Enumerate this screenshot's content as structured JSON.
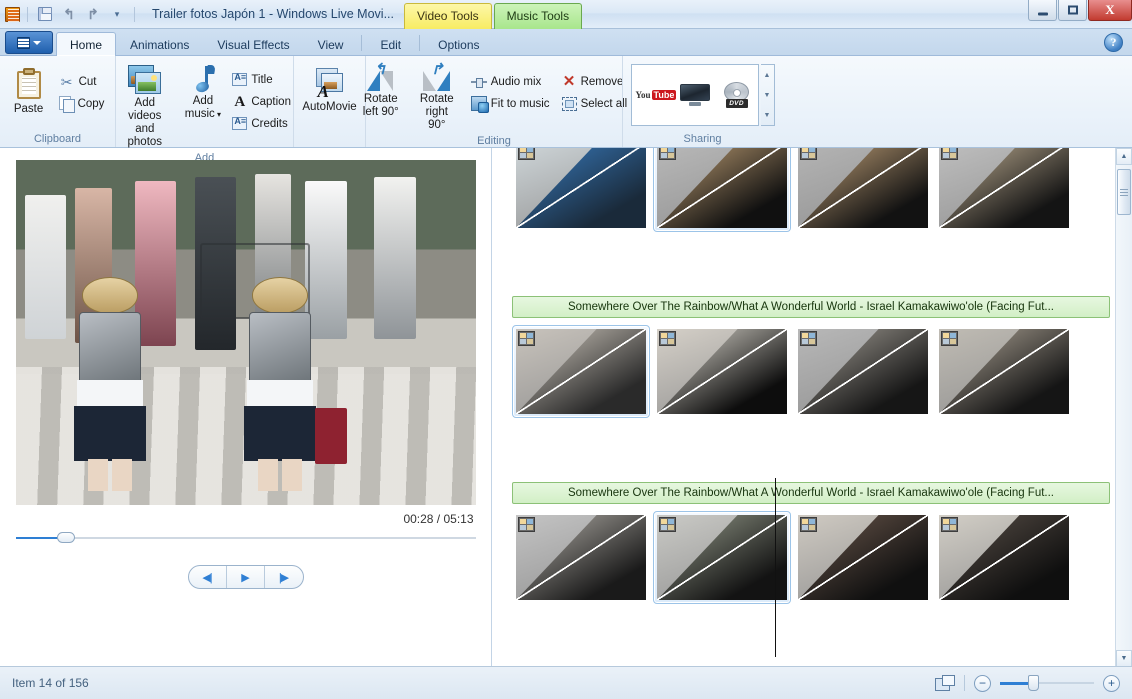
{
  "window": {
    "title": "Trailer fotos Japón 1 - Windows Live Movi...",
    "quick_access": {
      "save_tooltip": "Save project",
      "undo_tooltip": "Undo",
      "redo_tooltip": "Redo",
      "customize_tooltip": "Customize Quick Access Toolbar"
    },
    "contextual_tabs": [
      {
        "label": "Video Tools",
        "color": "#f7ec63"
      },
      {
        "label": "Music Tools",
        "color": "#a8e68c"
      }
    ],
    "controls": {
      "minimize": "–",
      "maximize": "□",
      "close": "X"
    }
  },
  "tabs": [
    {
      "label": "Home",
      "active": true
    },
    {
      "label": "Animations",
      "active": false
    },
    {
      "label": "Visual Effects",
      "active": false
    },
    {
      "label": "View",
      "active": false
    },
    {
      "label": "Edit",
      "active": false
    },
    {
      "label": "Options",
      "active": false
    }
  ],
  "help_label": "?",
  "ribbon": {
    "groups": [
      {
        "name": "Clipboard",
        "big": [
          {
            "label": "Paste",
            "icon": "paste-icon"
          }
        ],
        "small": [
          {
            "label": "Cut",
            "icon": "scissors-icon"
          },
          {
            "label": "Copy",
            "icon": "copy-icon"
          }
        ]
      },
      {
        "name": "Add",
        "big": [
          {
            "label_line1": "Add videos",
            "label_line2": "and photos",
            "icon": "add-videos-icon"
          },
          {
            "label_line1": "Add",
            "label_line2": "music",
            "icon": "add-music-icon",
            "has_dropdown": true
          }
        ],
        "small": [
          {
            "label": "Title",
            "icon": "title-icon"
          },
          {
            "label": "Caption",
            "icon": "caption-icon"
          },
          {
            "label": "Credits",
            "icon": "credits-icon"
          }
        ]
      },
      {
        "name": "",
        "big": [
          {
            "label": "AutoMovie",
            "icon": "automovie-icon"
          }
        ]
      },
      {
        "name": "Editing",
        "big": [
          {
            "label_line1": "Rotate",
            "label_line2": "left 90°",
            "icon": "rotate-left-icon"
          },
          {
            "label_line1": "Rotate",
            "label_line2": "right 90°",
            "icon": "rotate-right-icon"
          }
        ],
        "small": [
          {
            "label": "Audio mix",
            "icon": "audio-mix-icon"
          },
          {
            "label": "Fit to music",
            "icon": "fit-to-music-icon"
          }
        ],
        "small2": [
          {
            "label": "Remove",
            "icon": "remove-icon"
          },
          {
            "label": "Select all",
            "icon": "select-all-icon"
          }
        ]
      },
      {
        "name": "Sharing",
        "gallery": [
          {
            "label": "YouTube",
            "icon": "youtube-icon",
            "you": "You",
            "tube": "Tube"
          },
          {
            "label": "Display",
            "icon": "display-icon"
          },
          {
            "label": "DVD",
            "icon": "dvd-icon",
            "disc_label": "DVD"
          }
        ]
      }
    ]
  },
  "preview": {
    "current_time": "00:28",
    "total_time": "05:13",
    "time_display": "00:28 / 05:13",
    "progress_percent": 11,
    "controls": [
      {
        "name": "previous-frame",
        "glyph": "◀|"
      },
      {
        "name": "play",
        "glyph": "▶"
      },
      {
        "name": "next-frame",
        "glyph": "|▶"
      }
    ]
  },
  "storyboard": {
    "music_track_label": "Somewhere Over The Rainbow/What A Wonderful World - Israel Kamakawiwo'ole (Facing Fut...",
    "rows": [
      {
        "has_label": false,
        "clips": [
          {
            "selected": false,
            "a": "#cfd6d9",
            "b": "#3a7fc4",
            "c": "#1a2a3a"
          },
          {
            "selected": true,
            "a": "#b9b9b9",
            "b": "#c9a77a",
            "c": "#101010"
          },
          {
            "selected": false,
            "a": "#b5b5b5",
            "b": "#caa87d",
            "c": "#121212"
          },
          {
            "selected": false,
            "a": "#bfbfbf",
            "b": "#c9b79a",
            "c": "#141414"
          }
        ]
      },
      {
        "has_label": true,
        "clips": [
          {
            "selected": true,
            "a": "#c8c3bc",
            "b": "#d6cfc4",
            "c": "#2a2a2a"
          },
          {
            "selected": false,
            "a": "#d5d0c8",
            "b": "#e6e2d8",
            "c": "#0d0d0d"
          },
          {
            "selected": false,
            "a": "#b8b8b8",
            "b": "#a8a39a",
            "c": "#161616"
          },
          {
            "selected": false,
            "a": "#c0bcb4",
            "b": "#b5ab9c",
            "c": "#151515"
          }
        ]
      },
      {
        "has_label": true,
        "clips": [
          {
            "selected": false,
            "a": "#c4c4c4",
            "b": "#b9b5ae",
            "c": "#1a1a1a"
          },
          {
            "selected": true,
            "a": "#cacac6",
            "b": "#9aa08f",
            "c": "#131313"
          },
          {
            "selected": false,
            "a": "#cfcac2",
            "b": "#6e5a4e",
            "c": "#101010"
          },
          {
            "selected": false,
            "a": "#d2cec6",
            "b": "#5c524a",
            "c": "#0f0f0f"
          }
        ]
      }
    ],
    "playhead_visible": true
  },
  "status": {
    "item_text": "Item 14 of 156",
    "thumbnail_size_tooltip": "Thumbnail size",
    "zoom_out": "−",
    "zoom_in": "+",
    "zoom_percent": 35
  }
}
